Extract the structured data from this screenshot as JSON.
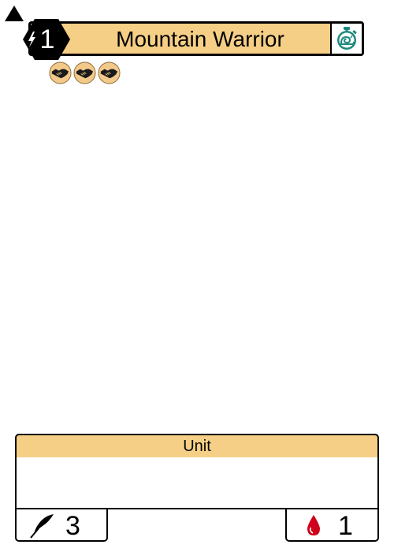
{
  "card": {
    "title": "Mountain Warrior",
    "cost": "1",
    "type_line": "Unit",
    "rules_text": "",
    "attack": "3",
    "health": "1"
  },
  "icons": {
    "corner": "triangle-icon",
    "cost": "lightning-bolt-icon",
    "speed": "stopwatch-snail-icon",
    "traits": [
      "handshake-icon",
      "handshake-icon",
      "handshake-icon"
    ],
    "attack": "quill-icon",
    "health": "blood-drop-icon"
  },
  "colors": {
    "banner": "#f6cf86",
    "speed_icon": "#1e8a7e",
    "health_icon": "#d0021b",
    "trait_coin": "#f3c98a"
  }
}
